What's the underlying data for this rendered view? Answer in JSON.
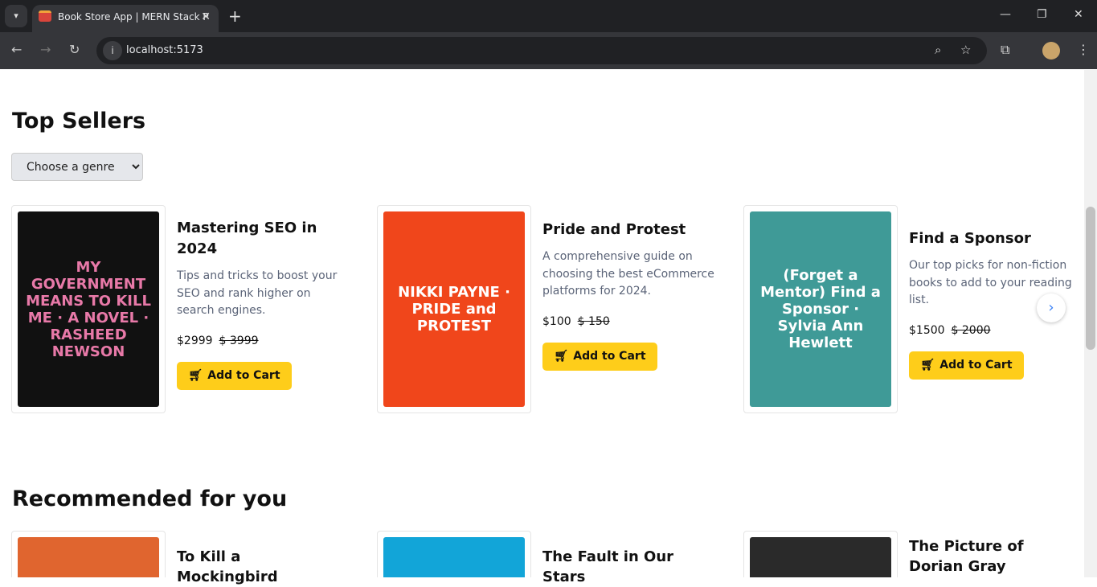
{
  "browser": {
    "tab_title": "Book Store App | MERN Stack P",
    "url": "localhost:5173"
  },
  "top_sellers": {
    "heading": "Top Sellers",
    "genre_select": "Choose a genre",
    "books": [
      {
        "title": "Mastering SEO in 2024",
        "description": "Tips and tricks to boost your SEO and rank higher on search engines.",
        "price": "$2999",
        "old_price": "$ 3999",
        "cover_text": "MY GOVERNMENT MEANS TO KILL ME · A NOVEL · RASHEED NEWSON",
        "cover_color": "#111111"
      },
      {
        "title": "Pride and Protest",
        "description": "A comprehensive guide on choosing the best eCommerce platforms for 2024.",
        "price": "$100",
        "old_price": "$ 150",
        "cover_text": "NIKKI PAYNE · PRIDE and PROTEST",
        "cover_color": "#f0461b"
      },
      {
        "title": "Find a Sponsor",
        "description": "Our top picks for non-fiction books to add to your reading list.",
        "price": "$1500",
        "old_price": "$ 2000",
        "cover_text": "(Forget a Mentor) Find a Sponsor · Sylvia Ann Hewlett",
        "cover_color": "#3f9a97"
      }
    ],
    "add_to_cart": "Add to Cart"
  },
  "recommended": {
    "heading": "Recommended for you",
    "books": [
      {
        "title": "To Kill a Mockingbird",
        "cover_color": "#e0652f"
      },
      {
        "title": "The Fault in Our Stars",
        "cover_color": "#12a5d8"
      },
      {
        "title": "The Picture of Dorian Gray",
        "cover_color": "#2a2a2a"
      }
    ]
  }
}
